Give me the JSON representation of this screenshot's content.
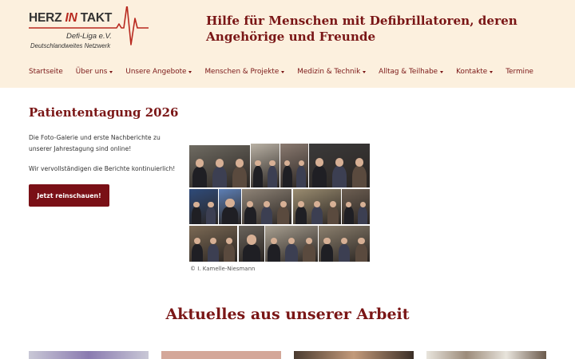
{
  "logo": {
    "brand_part1": "HERZ ",
    "brand_part2": "IN",
    "brand_part3": " TAKT",
    "subtitle": "Defi-Liga e.V.",
    "network": "Deutschlandweites Netzwerk",
    "accent": "#b8291f"
  },
  "header": {
    "tagline": "Hilfe für Menschen mit Defibrillatoren, deren Angehörige und Freunde",
    "background": "#fcf0de"
  },
  "nav": {
    "items": [
      {
        "label": "Startseite",
        "dropdown": false
      },
      {
        "label": "Über uns",
        "dropdown": true
      },
      {
        "label": "Unsere Angebote",
        "dropdown": true
      },
      {
        "label": "Menschen & Projekte",
        "dropdown": true
      },
      {
        "label": "Medizin & Technik",
        "dropdown": true
      },
      {
        "label": "Alltag & Teilhabe",
        "dropdown": true
      },
      {
        "label": "Kontakte",
        "dropdown": true
      },
      {
        "label": "Termine",
        "dropdown": false
      }
    ],
    "color": "#7a1616"
  },
  "feature": {
    "title": "Patiententagung 2026",
    "paragraph1": "Die Foto-Galerie und erste Nachberichte zu unserer Jahrestagung sind online!",
    "paragraph2": "Wir vervollständigen die Berichte kontinuierlich!",
    "cta_label": "Jetzt reinschauen!",
    "cta_color": "#7a1016",
    "photo_credit": "© I. Kamelle-Niesmann"
  },
  "news": {
    "title": "Aktuelles aus unserer Arbeit"
  }
}
